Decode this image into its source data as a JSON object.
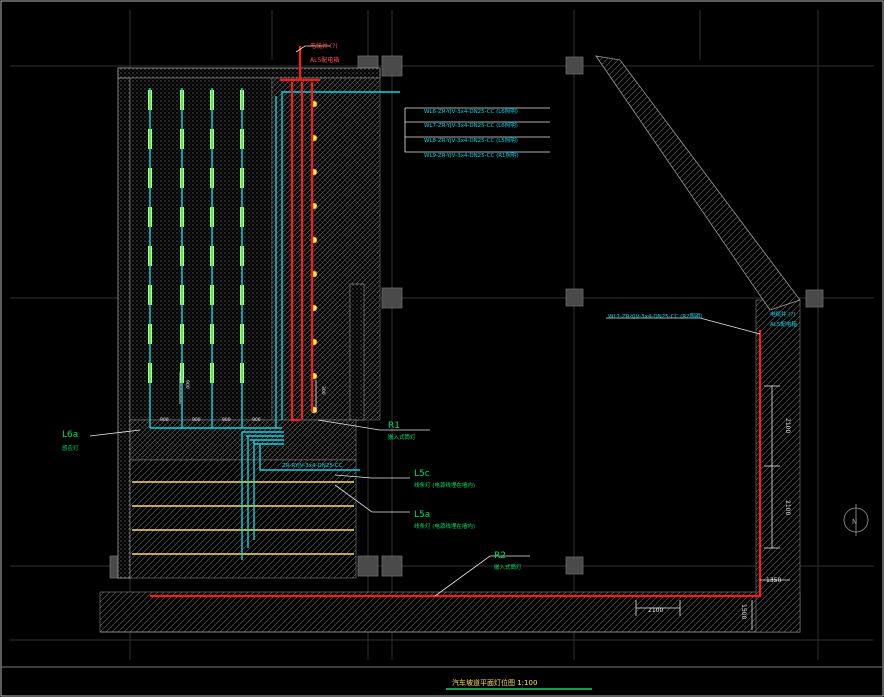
{
  "colors": {
    "background": "#000000",
    "frame": "#b8b8b8",
    "grid": "#2f2f2f",
    "hatch": "#8a8a8a",
    "fixture": "#c8ff3a",
    "cyan": "#00d8e8",
    "red": "#ff1a1a",
    "yellow": "#ffe24a",
    "green": "#00e060",
    "white": "#e6e6e6",
    "column": "#4a4a4a"
  },
  "panel_top": {
    "line1": "电缆井 (?)",
    "line2": "AL5配电箱"
  },
  "panel_right": {
    "line1": "电缆井 (?)",
    "line2": "AL5配电箱"
  },
  "circuit_labels": [
    "WL6-ZR-YJV-3x4-DN25-CC (L6照明)",
    "WL7-ZR-YJV-3x4-DN25-CC (L6照明)",
    "WL8-ZR-YJV-3x4-DN25-CC (L5照明)",
    "WL9-ZR-YJV-3x4-DN25-CC (R1照明)"
  ],
  "right_circuit_label": "WL1-ZR-YJV-3x4-DN25-CC (R2照明)",
  "mid_circuit_label": "ZR-RYJV-3x4-DN25-CC",
  "callouts": {
    "r1": {
      "tag": "R1",
      "desc": "嵌入式筒灯"
    },
    "l6a": {
      "tag": "L6a",
      "desc": "感应灯"
    },
    "l5c": {
      "tag": "L5c",
      "desc": "线条灯 (电源线埋在墙内)"
    },
    "l5a": {
      "tag": "L5a",
      "desc": "线条灯 (电源线埋在墙内)"
    },
    "r2": {
      "tag": "R2",
      "desc": "嵌入式筒灯"
    }
  },
  "dimensions": {
    "vertical_1": "2100",
    "vertical_2": "2100",
    "horizontal": "2100",
    "corner_h": "1350",
    "corner_v": "1500",
    "spacing_1": "900",
    "spacing_2": "900",
    "spacing_3": "900",
    "spacing_4": "900",
    "bay_v": "900",
    "riser_v": "300"
  },
  "title": "汽车坡道平面灯位图 1:100",
  "north_symbol": "N",
  "fixture_layout": {
    "columns": 4,
    "rows": 8
  },
  "downlight_count": 10,
  "linear_light_count": 4
}
